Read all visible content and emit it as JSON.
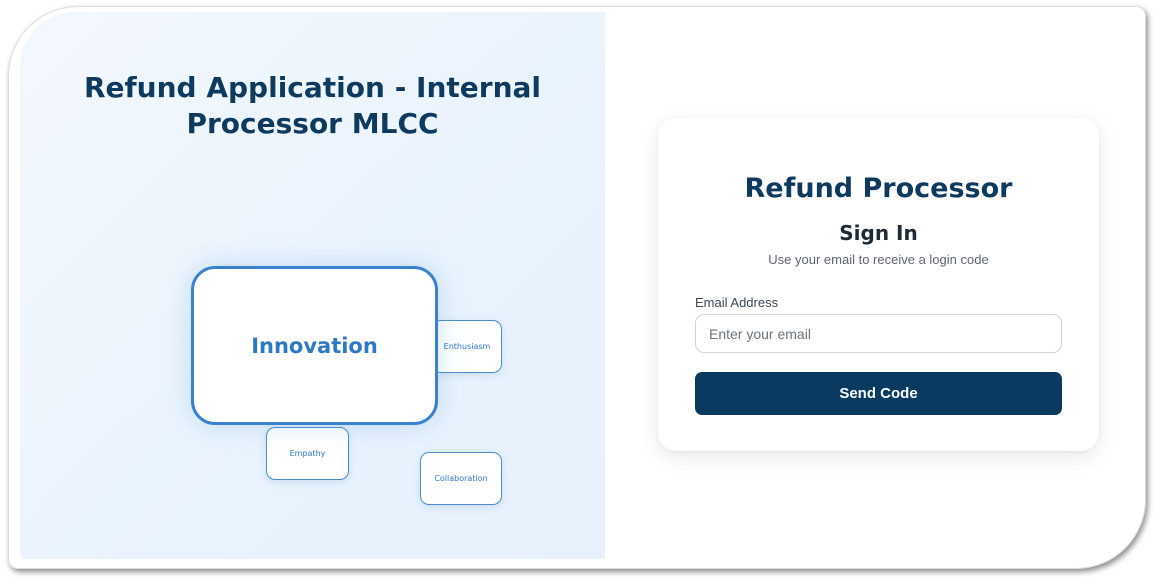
{
  "left": {
    "title_line1": "Refund Application - Internal",
    "title_line2": "Processor MLCC",
    "cards": {
      "main": "Innovation",
      "enthusiasm": "Enthusiasm",
      "empathy": "Empathy",
      "collaboration": "Collaboration"
    }
  },
  "login": {
    "title": "Refund Processor",
    "subtitle": "Sign In",
    "description": "Use your email to receive a login code",
    "email_label": "Email Address",
    "email_placeholder": "Enter your email",
    "email_value": "",
    "button_label": "Send Code"
  },
  "colors": {
    "brand_navy": "#0b3a60",
    "accent_blue": "#3a82cf",
    "left_panel_bg": "#e9f3fd"
  }
}
